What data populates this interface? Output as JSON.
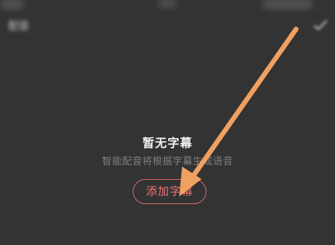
{
  "header": {
    "back_label": "配音"
  },
  "empty_state": {
    "title": "暂无字幕",
    "description": "智能配音将根据字幕生成语音",
    "add_button_label": "添加字幕"
  },
  "annotation": {
    "arrow_color": "#f0a060"
  },
  "colors": {
    "background": "#333333",
    "accent": "#e86a6a"
  }
}
